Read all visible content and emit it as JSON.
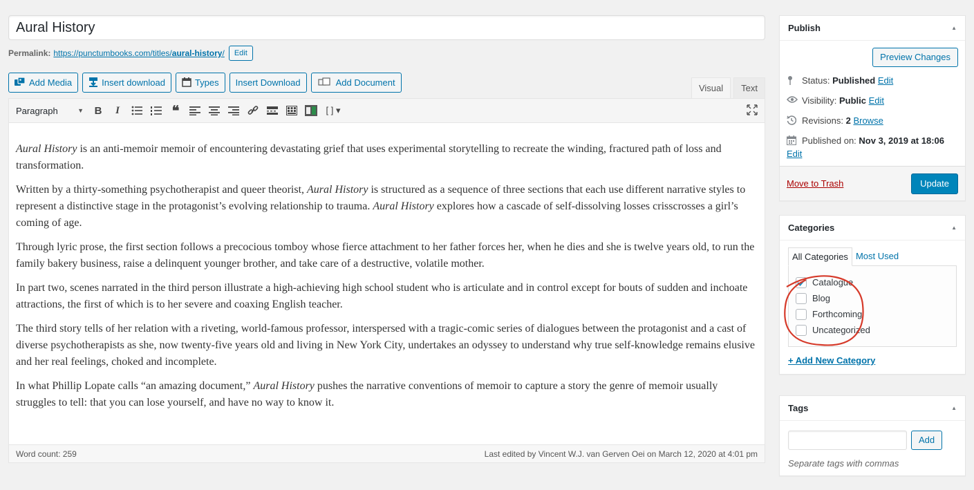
{
  "editor": {
    "title": "Aural History",
    "permalink_label": "Permalink:",
    "permalink_base": "https://punctumbooks.com/titles/",
    "permalink_slug": "aural-history",
    "permalink_tail": "/",
    "permalink_edit": "Edit",
    "media_buttons": [
      {
        "label": "Add Media",
        "icon": "media-icon"
      },
      {
        "label": "Insert download",
        "icon": "download-icon"
      },
      {
        "label": "Types",
        "icon": "calendar-icon"
      },
      {
        "label": "Insert Download",
        "icon": ""
      },
      {
        "label": "Add Document",
        "icon": "document-icon"
      }
    ],
    "tabs": {
      "visual": "Visual",
      "text": "Text"
    },
    "format_select": "Paragraph",
    "paragraphs": [
      [
        {
          "t": "Aural History",
          "i": true
        },
        {
          "t": " is an anti-memoir memoir of encountering devastating grief that uses experimental storytelling to recreate the winding, fractured path of loss and transformation."
        }
      ],
      [
        {
          "t": "Written by a thirty-something psychotherapist and queer theorist, "
        },
        {
          "t": "Aural History",
          "i": true
        },
        {
          "t": " is structured as a sequence of three sections that each use different narrative styles to represent a distinctive stage in the protagonist’s evolving relationship to trauma. "
        },
        {
          "t": "Aural History",
          "i": true
        },
        {
          "t": " explores how a cascade of self-dissolving losses crisscrosses a girl’s coming of age."
        }
      ],
      [
        {
          "t": "Through lyric prose, the first section follows a precocious tomboy whose fierce attachment to her father forces her, when he dies and she is twelve years old, to run the family bakery business, raise a delinquent younger brother, and take care of a destructive, volatile mother."
        }
      ],
      [
        {
          "t": "In part two, scenes narrated in the third person illustrate a high-achieving high school student who is articulate and in control except for bouts of sudden and inchoate attractions, the first of which is to her severe and coaxing English teacher."
        }
      ],
      [
        {
          "t": "The third story tells of her relation with a riveting, world-famous professor, interspersed with a tragic-comic series of dialogues between the protagonist and a cast of diverse psychotherapists as she, now twenty-five years old and living in New York City, undertakes an odyssey to understand why true self-knowledge remains elusive and her real feelings, choked and incomplete."
        }
      ],
      [
        {
          "t": "In what Phillip Lopate calls “an amazing document,” "
        },
        {
          "t": "Aural History",
          "i": true
        },
        {
          "t": " pushes the narrative conventions of memoir to capture a story the genre of memoir usually struggles to tell: that you can lose yourself, and have no way to know it."
        }
      ]
    ],
    "word_count": "Word count: 259",
    "last_edited": "Last edited by Vincent W.J. van Gerven Oei on March 12, 2020 at 4:01 pm"
  },
  "publish": {
    "title": "Publish",
    "preview": "Preview Changes",
    "status_label": "Status:",
    "status_value": "Published",
    "visibility_label": "Visibility:",
    "visibility_value": "Public",
    "revisions_label": "Revisions:",
    "revisions_value": "2",
    "browse": "Browse",
    "published_label": "Published on:",
    "published_value": "Nov 3, 2019 at 18:06",
    "edit": "Edit",
    "trash": "Move to Trash",
    "update": "Update"
  },
  "categories": {
    "title": "Categories",
    "tab_all": "All Categories",
    "tab_used": "Most Used",
    "items": [
      {
        "label": "Catalogue",
        "checked": true
      },
      {
        "label": "Blog",
        "checked": false
      },
      {
        "label": "Forthcoming",
        "checked": false
      },
      {
        "label": "Uncategorized",
        "checked": false
      }
    ],
    "add_new": "+ Add New Category"
  },
  "tags": {
    "title": "Tags",
    "add": "Add",
    "help": "Separate tags with commas",
    "value": ""
  },
  "colors": {
    "accent": "#0073aa",
    "primary": "#0085ba",
    "danger": "#a00000",
    "annotation": "#d63a2a"
  }
}
